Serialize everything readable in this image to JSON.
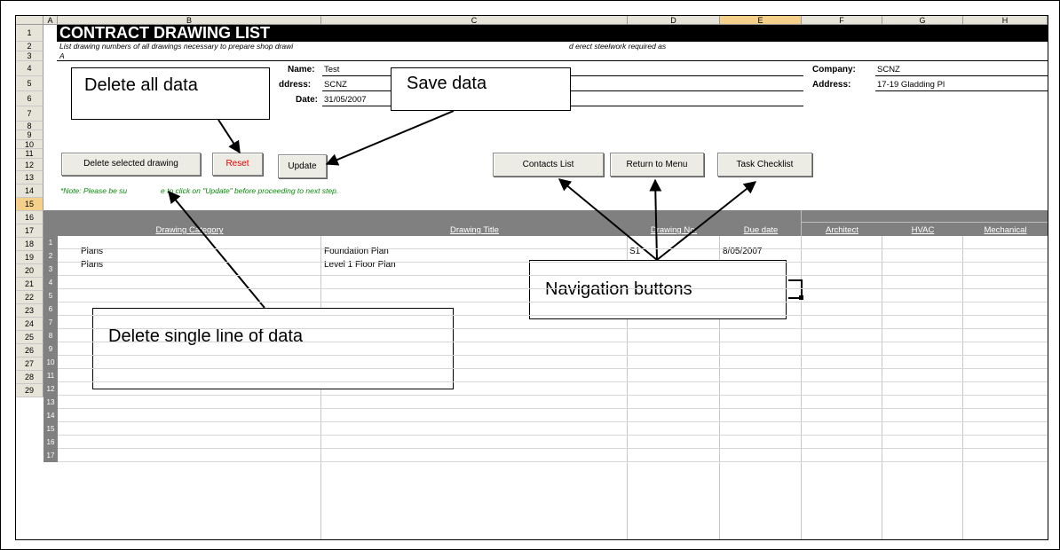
{
  "sheet": {
    "columns": [
      "A",
      "B",
      "C",
      "D",
      "E",
      "F",
      "G",
      "H"
    ],
    "selected_column": "E",
    "rows": [
      "1",
      "2",
      "3",
      "4",
      "5",
      "6",
      "7",
      "8",
      "9",
      "10",
      "11",
      "12",
      "13",
      "14",
      "15",
      "16",
      "17",
      "18",
      "19",
      "20",
      "21",
      "22",
      "23",
      "24",
      "25",
      "26",
      "27",
      "28",
      "29"
    ],
    "selected_row": "15",
    "title": "CONTRACT DRAWING LIST",
    "instruction_line2": "List drawing numbers of all drawings necessary to prepare shop drawi",
    "instruction_line2_tail": "d erect steelwork required as",
    "instruction_line3": "A",
    "note": "*Note: Please be su",
    "note_tail": "e to click on \"Update\" before proceeding to next step."
  },
  "project": {
    "name_label": "Name:",
    "name_value": "Test",
    "address_label": "ddress:",
    "address_value": "SCNZ",
    "date_label": "Date:",
    "date_value": "31/05/2007",
    "company_label": "Company:",
    "company_value": "SCNZ",
    "company_address_label": "Address:",
    "company_address_value": "17-19 Gladding Pl"
  },
  "buttons": {
    "delete_selected": "Delete selected drawing",
    "reset": "Reset",
    "update": "Update",
    "contacts": "Contacts List",
    "return_menu": "Return to Menu",
    "task_checklist": "Task Checklist"
  },
  "table": {
    "headers": {
      "category": "Drawing Category",
      "title": "Drawing Title",
      "number": "Drawing No.",
      "due": "Due date",
      "architect": "Architect",
      "hvac": "HVAC",
      "mechanical": "Mechanical"
    },
    "row_numbers": [
      "1",
      "2",
      "3",
      "4",
      "5",
      "6",
      "7",
      "8",
      "9",
      "10",
      "11",
      "12",
      "13",
      "14",
      "15",
      "16",
      "17"
    ],
    "rows": [
      {
        "category": "Plans",
        "title": "Foundation Plan",
        "number": "S1",
        "due": "8/05/2007"
      },
      {
        "category": "Plans",
        "title": "Level 1 Floor Plan",
        "number": "",
        "due": ""
      }
    ]
  },
  "callouts": {
    "delete_all": "Delete all data",
    "save": "Save data",
    "navigation": "Navigation buttons",
    "delete_single": "Delete single line of data"
  },
  "colors": {
    "title_bg": "#000000",
    "table_header_bg": "#808080",
    "reset_text": "#e00000",
    "note_text": "#0a8a0a",
    "selected_header": "#f4d08a"
  }
}
